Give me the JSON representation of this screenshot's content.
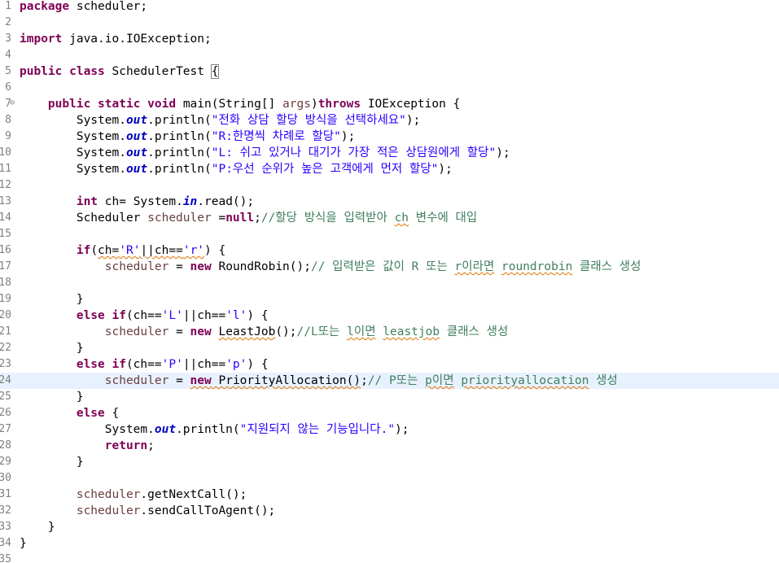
{
  "editor": {
    "language": "java",
    "current_line": "24",
    "colors": {
      "keyword": "#7f0055",
      "string": "#2a00ff",
      "comment": "#3f7f5f",
      "static_field": "#0000c0",
      "current_line_bg": "#e8f2fe"
    },
    "lines": [
      {
        "num": "1",
        "fold": "",
        "segs": [
          {
            "t": "kw",
            "v": "package"
          },
          {
            "t": "",
            "v": " scheduler;"
          }
        ]
      },
      {
        "num": "2",
        "fold": "",
        "segs": []
      },
      {
        "num": "3",
        "fold": "",
        "segs": [
          {
            "t": "kw",
            "v": "import"
          },
          {
            "t": "",
            "v": " java.io.IOException;"
          }
        ]
      },
      {
        "num": "4",
        "fold": "",
        "segs": []
      },
      {
        "num": "5",
        "fold": "",
        "segs": [
          {
            "t": "kw",
            "v": "public"
          },
          {
            "t": "",
            "v": " "
          },
          {
            "t": "kw",
            "v": "class"
          },
          {
            "t": "",
            "v": " SchedulerTest "
          },
          {
            "t": "box",
            "v": "{"
          }
        ]
      },
      {
        "num": "6",
        "fold": "",
        "segs": []
      },
      {
        "num": "7",
        "fold": "⊖",
        "segs": [
          {
            "t": "",
            "v": "    "
          },
          {
            "t": "kw",
            "v": "public"
          },
          {
            "t": "",
            "v": " "
          },
          {
            "t": "kw",
            "v": "static"
          },
          {
            "t": "",
            "v": " "
          },
          {
            "t": "kw",
            "v": "void"
          },
          {
            "t": "",
            "v": " main(String[] "
          },
          {
            "t": "var",
            "v": "args"
          },
          {
            "t": "",
            "v": ")"
          },
          {
            "t": "kw",
            "v": "throws"
          },
          {
            "t": "",
            "v": " IOException {"
          }
        ]
      },
      {
        "num": "8",
        "fold": "",
        "segs": [
          {
            "t": "",
            "v": "        System."
          },
          {
            "t": "field",
            "v": "out"
          },
          {
            "t": "",
            "v": ".println("
          },
          {
            "t": "str",
            "v": "\"전화 상담 할당 방식을 선택하세요\""
          },
          {
            "t": "",
            "v": ");"
          }
        ]
      },
      {
        "num": "9",
        "fold": "",
        "segs": [
          {
            "t": "",
            "v": "        System."
          },
          {
            "t": "field",
            "v": "out"
          },
          {
            "t": "",
            "v": ".println("
          },
          {
            "t": "str",
            "v": "\"R:한명씩 차례로 할당\""
          },
          {
            "t": "",
            "v": ");"
          }
        ]
      },
      {
        "num": "10",
        "fold": "",
        "segs": [
          {
            "t": "",
            "v": "        System."
          },
          {
            "t": "field",
            "v": "out"
          },
          {
            "t": "",
            "v": ".println("
          },
          {
            "t": "str",
            "v": "\"L: 쉬고 있거나 대기가 가장 적은 상담원에게 할당\""
          },
          {
            "t": "",
            "v": ");"
          }
        ]
      },
      {
        "num": "11",
        "fold": "",
        "segs": [
          {
            "t": "",
            "v": "        System."
          },
          {
            "t": "field",
            "v": "out"
          },
          {
            "t": "",
            "v": ".println("
          },
          {
            "t": "str",
            "v": "\"P:우선 순위가 높은 고객에게 먼저 할당\""
          },
          {
            "t": "",
            "v": ");"
          }
        ]
      },
      {
        "num": "12",
        "fold": "",
        "segs": []
      },
      {
        "num": "13",
        "fold": "",
        "segs": [
          {
            "t": "",
            "v": "        "
          },
          {
            "t": "kw",
            "v": "int"
          },
          {
            "t": "",
            "v": " ch= System."
          },
          {
            "t": "field",
            "v": "in"
          },
          {
            "t": "",
            "v": ".read();"
          }
        ]
      },
      {
        "num": "14",
        "fold": "",
        "segs": [
          {
            "t": "",
            "v": "        Scheduler "
          },
          {
            "t": "var",
            "v": "scheduler"
          },
          {
            "t": "",
            "v": " ="
          },
          {
            "t": "kw",
            "v": "null"
          },
          {
            "t": "",
            "v": ";"
          },
          {
            "t": "cmt",
            "v": "//할당 방식을 입력받아 "
          },
          {
            "t": "cmtw",
            "v": "ch"
          },
          {
            "t": "cmt",
            "v": " 변수에 대입"
          }
        ]
      },
      {
        "num": "15",
        "fold": "",
        "segs": []
      },
      {
        "num": "16",
        "fold": "",
        "segs": [
          {
            "t": "",
            "v": "        "
          },
          {
            "t": "kw",
            "v": "if"
          },
          {
            "t": "",
            "v": "("
          },
          {
            "t": "warn",
            "v": "ch="
          },
          {
            "t": "strw",
            "v": "'R'"
          },
          {
            "t": "warn",
            "v": "||ch=="
          },
          {
            "t": "strw",
            "v": "'r'"
          },
          {
            "t": "",
            "v": ") {"
          }
        ]
      },
      {
        "num": "17",
        "fold": "",
        "segs": [
          {
            "t": "",
            "v": "            "
          },
          {
            "t": "var",
            "v": "scheduler"
          },
          {
            "t": "",
            "v": " = "
          },
          {
            "t": "kw",
            "v": "new"
          },
          {
            "t": "",
            "v": " RoundRobin();"
          },
          {
            "t": "cmt",
            "v": "// 입력받은 값이 R 또는 "
          },
          {
            "t": "cmtw",
            "v": "r이라면"
          },
          {
            "t": "cmt",
            "v": " "
          },
          {
            "t": "cmtw",
            "v": "roundrobin"
          },
          {
            "t": "cmt",
            "v": " 클래스 생성"
          }
        ]
      },
      {
        "num": "18",
        "fold": "",
        "segs": []
      },
      {
        "num": "19",
        "fold": "",
        "segs": [
          {
            "t": "",
            "v": "        }"
          }
        ]
      },
      {
        "num": "20",
        "fold": "",
        "segs": [
          {
            "t": "",
            "v": "        "
          },
          {
            "t": "kw",
            "v": "else if"
          },
          {
            "t": "",
            "v": "(ch=="
          },
          {
            "t": "str",
            "v": "'L'"
          },
          {
            "t": "",
            "v": "||ch=="
          },
          {
            "t": "str",
            "v": "'l'"
          },
          {
            "t": "",
            "v": ") {"
          }
        ]
      },
      {
        "num": "21",
        "fold": "",
        "segs": [
          {
            "t": "",
            "v": "            "
          },
          {
            "t": "var",
            "v": "scheduler"
          },
          {
            "t": "",
            "v": " = "
          },
          {
            "t": "kw",
            "v": "new"
          },
          {
            "t": "",
            "v": " "
          },
          {
            "t": "warn",
            "v": "LeastJob"
          },
          {
            "t": "",
            "v": "();"
          },
          {
            "t": "cmt",
            "v": "//L또는 "
          },
          {
            "t": "cmtw",
            "v": "l이면"
          },
          {
            "t": "cmt",
            "v": " "
          },
          {
            "t": "cmtw",
            "v": "leastjob"
          },
          {
            "t": "cmt",
            "v": " 클래스 생성"
          }
        ]
      },
      {
        "num": "22",
        "fold": "",
        "segs": [
          {
            "t": "",
            "v": "        }"
          }
        ]
      },
      {
        "num": "23",
        "fold": "",
        "segs": [
          {
            "t": "",
            "v": "        "
          },
          {
            "t": "kw",
            "v": "else if"
          },
          {
            "t": "",
            "v": "(ch=="
          },
          {
            "t": "str",
            "v": "'P'"
          },
          {
            "t": "",
            "v": "||ch=="
          },
          {
            "t": "str",
            "v": "'p'"
          },
          {
            "t": "",
            "v": ") {"
          }
        ]
      },
      {
        "num": "24",
        "fold": "",
        "segs": [
          {
            "t": "",
            "v": "            "
          },
          {
            "t": "var",
            "v": "scheduler"
          },
          {
            "t": "",
            "v": " = "
          },
          {
            "t": "kww",
            "v": "new"
          },
          {
            "t": "warn",
            "v": " PriorityAllocation()"
          },
          {
            "t": "",
            "v": ";"
          },
          {
            "t": "cmt",
            "v": "// P또는 "
          },
          {
            "t": "cmtw",
            "v": "p이면"
          },
          {
            "t": "cmt",
            "v": " "
          },
          {
            "t": "cmtw",
            "v": "priorityallocation"
          },
          {
            "t": "cmt",
            "v": " 생성"
          }
        ]
      },
      {
        "num": "25",
        "fold": "",
        "segs": [
          {
            "t": "",
            "v": "        }"
          }
        ]
      },
      {
        "num": "26",
        "fold": "",
        "segs": [
          {
            "t": "",
            "v": "        "
          },
          {
            "t": "kw",
            "v": "else"
          },
          {
            "t": "",
            "v": " {"
          }
        ]
      },
      {
        "num": "27",
        "fold": "",
        "segs": [
          {
            "t": "",
            "v": "            System."
          },
          {
            "t": "field",
            "v": "out"
          },
          {
            "t": "",
            "v": ".println("
          },
          {
            "t": "str",
            "v": "\"지원되지 않는 기능입니다.\""
          },
          {
            "t": "",
            "v": ");"
          }
        ]
      },
      {
        "num": "28",
        "fold": "",
        "segs": [
          {
            "t": "",
            "v": "            "
          },
          {
            "t": "kw",
            "v": "return"
          },
          {
            "t": "",
            "v": ";"
          }
        ]
      },
      {
        "num": "29",
        "fold": "",
        "segs": [
          {
            "t": "",
            "v": "        }"
          }
        ]
      },
      {
        "num": "30",
        "fold": "",
        "segs": []
      },
      {
        "num": "31",
        "fold": "",
        "segs": [
          {
            "t": "",
            "v": "        "
          },
          {
            "t": "var",
            "v": "scheduler"
          },
          {
            "t": "",
            "v": ".getNextCall();"
          }
        ]
      },
      {
        "num": "32",
        "fold": "",
        "segs": [
          {
            "t": "",
            "v": "        "
          },
          {
            "t": "var",
            "v": "scheduler"
          },
          {
            "t": "",
            "v": ".sendCallToAgent();"
          }
        ]
      },
      {
        "num": "33",
        "fold": "",
        "segs": [
          {
            "t": "",
            "v": "    }"
          }
        ]
      },
      {
        "num": "34",
        "fold": "",
        "segs": [
          {
            "t": "",
            "v": "}"
          }
        ]
      },
      {
        "num": "35",
        "fold": "",
        "segs": []
      }
    ]
  }
}
